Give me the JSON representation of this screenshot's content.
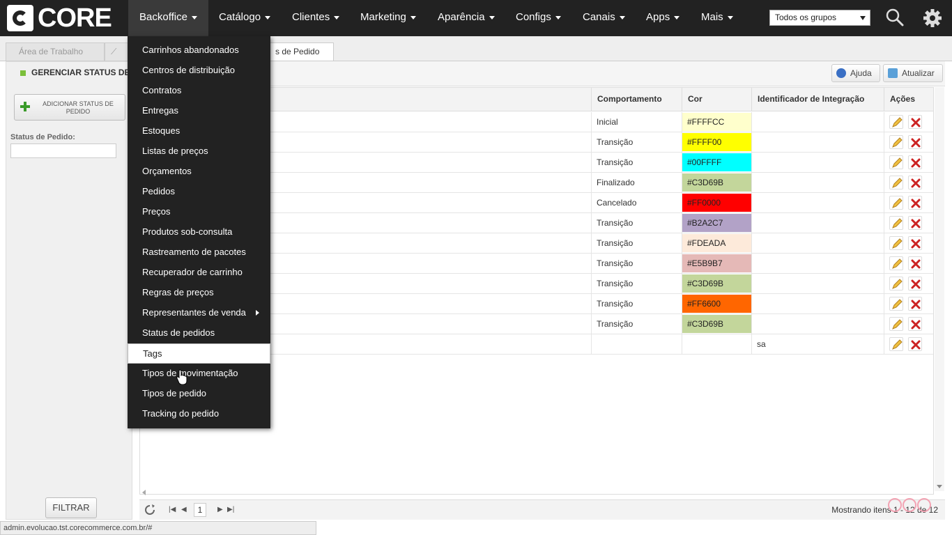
{
  "logo_text": "CORE",
  "nav": {
    "items": [
      {
        "label": "Backoffice",
        "active": true
      },
      {
        "label": "Catálogo"
      },
      {
        "label": "Clientes"
      },
      {
        "label": "Marketing"
      },
      {
        "label": "Aparência"
      },
      {
        "label": "Configs"
      },
      {
        "label": "Canais"
      },
      {
        "label": "Apps"
      },
      {
        "label": "Mais"
      }
    ],
    "group_select": "Todos os grupos"
  },
  "tabs": [
    {
      "label": "Área de Trabalho"
    },
    {
      "label": "C"
    },
    {
      "label": "s de Pedido",
      "active": true
    }
  ],
  "left_panel": {
    "title": "GERENCIAR STATUS DE",
    "add_button": "ADICIONAR STATUS DE PEDIDO",
    "status_label": "Status de Pedido:",
    "filter_button": "FILTRAR"
  },
  "toolbar": {
    "help_label": "Ajuda",
    "refresh_label": "Atualizar"
  },
  "grid": {
    "headers": [
      "Comportamento",
      "Cor",
      "Identificador de Integração",
      "Ações"
    ],
    "rows": [
      {
        "behavior": "Inicial",
        "color": "#FFFFCC",
        "integration": ""
      },
      {
        "behavior": "Transição",
        "color": "#FFFF00",
        "integration": ""
      },
      {
        "behavior": "Transição",
        "color": "#00FFFF",
        "integration": ""
      },
      {
        "behavior": "Finalizado",
        "color": "#C3D69B",
        "integration": ""
      },
      {
        "behavior": "Cancelado",
        "color": "#FF0000",
        "integration": ""
      },
      {
        "behavior": "Transição",
        "color": "#B2A2C7",
        "integration": ""
      },
      {
        "behavior": "Transição",
        "color": "#FDEADA",
        "integration": ""
      },
      {
        "behavior": "Transição",
        "color": "#E5B9B7",
        "integration": ""
      },
      {
        "behavior": "Transição",
        "color": "#C3D69B",
        "integration": ""
      },
      {
        "behavior": "Transição",
        "color": "#FF6600",
        "integration": ""
      },
      {
        "behavior": "Transição",
        "color": "#C3D69B",
        "integration": ""
      },
      {
        "behavior": "",
        "color": "",
        "integration": "sa"
      }
    ]
  },
  "pager": {
    "page": "1",
    "info": "Mostrando itens 1 - 12 de 12"
  },
  "status_url": "admin.evolucao.tst.corecommerce.com.br/#",
  "menu": {
    "items": [
      {
        "label": "Carrinhos abandonados"
      },
      {
        "label": "Centros de distribuição"
      },
      {
        "label": "Contratos"
      },
      {
        "label": "Entregas"
      },
      {
        "label": "Estoques"
      },
      {
        "label": "Listas de preços"
      },
      {
        "label": "Orçamentos"
      },
      {
        "label": "Pedidos"
      },
      {
        "label": "Preços"
      },
      {
        "label": "Produtos sob-consulta"
      },
      {
        "label": "Rastreamento de pacotes"
      },
      {
        "label": "Recuperador de carrinho"
      },
      {
        "label": "Regras de preços"
      },
      {
        "label": "Representantes de venda",
        "submenu": true
      },
      {
        "label": "Status de pedidos"
      },
      {
        "label": "Tags",
        "highlighted": true
      },
      {
        "label": "Tipos de movimentação"
      },
      {
        "label": "Tipos de pedido"
      },
      {
        "label": "Tracking do pedido"
      }
    ]
  },
  "colors": {
    "nav_bg": "#222222",
    "accent_green": "#7BBF3A",
    "delete_red": "#CC2222"
  }
}
